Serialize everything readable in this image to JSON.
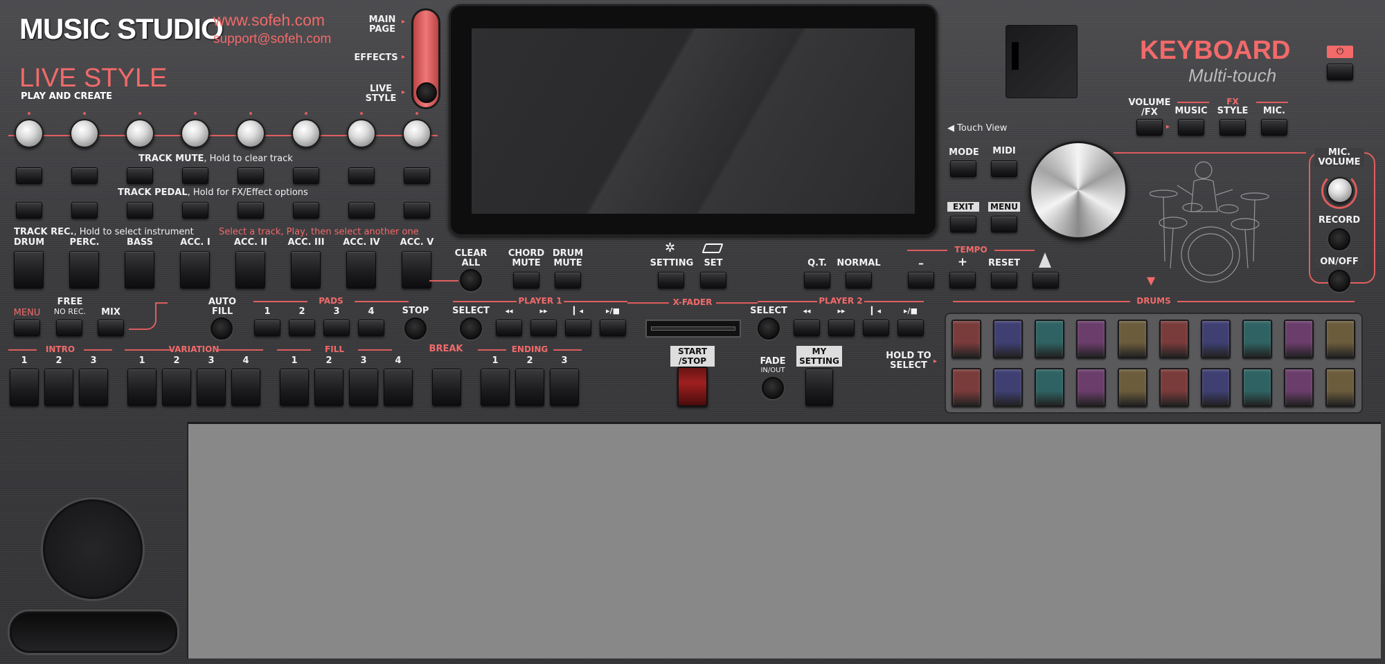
{
  "brand": {
    "title": "MUSIC STUDIO",
    "website": "www.sofeh.com",
    "email": "support@sofeh.com"
  },
  "style_header": {
    "title": "LIVE STYLE",
    "subtitle": "PLAY AND CREATE"
  },
  "page_switch": {
    "main_page": "MAIN PAGE",
    "effects": "EFFECTS",
    "live_style": "LIVE STYLE"
  },
  "keyboard": {
    "title": "KEYBOARD",
    "subtitle": "Multi-touch"
  },
  "touch_view": "Touch View",
  "track_mute_label": "TRACK MUTE",
  "track_mute_hint": ", Hold to clear track",
  "track_pedal_label": "TRACK PEDAL",
  "track_pedal_hint": ", Hold for FX/Effect options",
  "track_rec_label": "TRACK REC.",
  "track_rec_hint": ", Hold to select instrument",
  "track_rec_note": "Select a track, Play, then select another one",
  "tracks": [
    "DRUM",
    "PERC.",
    "BASS",
    "ACC. I",
    "ACC. II",
    "ACC. III",
    "ACC. IV",
    "ACC. V"
  ],
  "clear_all": "CLEAR ALL",
  "chord_mute": "CHORD MUTE",
  "drum_mute": "DRUM MUTE",
  "setting": "SETTING",
  "set": "SET",
  "mode": "MODE",
  "midi": "MIDI",
  "exit": "EXIT",
  "menu_btn": "MENU",
  "qt": "Q.T.",
  "normal": "NORMAL",
  "tempo": {
    "label": "TEMPO",
    "minus": "–",
    "plus": "+",
    "reset": "RESET"
  },
  "fx": {
    "volume_fx": "VOLUME /FX",
    "group": "FX",
    "music": "MUSIC",
    "style": "STYLE",
    "mic": "MIC."
  },
  "mic": {
    "volume": "MIC. VOLUME",
    "record": "RECORD",
    "onoff": "ON/OFF"
  },
  "left_menu": {
    "menu": "MENU",
    "free": "FREE",
    "no_rec": "NO REC.",
    "mix": "MIX",
    "auto_fill": "AUTO FILL"
  },
  "pads": {
    "label": "PADS",
    "items": [
      "1",
      "2",
      "3",
      "4"
    ],
    "stop": "STOP"
  },
  "player1": {
    "label": "PLAYER 1",
    "select": "SELECT"
  },
  "player2": {
    "label": "PLAYER 2",
    "select": "SELECT"
  },
  "xfader": "X-FADER",
  "transport": [
    "◂◂",
    "▸▸",
    "▎◂",
    "▸/■"
  ],
  "drums_label": "DRUMS",
  "hold_to_select": "HOLD TO SELECT",
  "intro": {
    "label": "INTRO",
    "items": [
      "1",
      "2",
      "3"
    ]
  },
  "variation": {
    "label": "VARIATION",
    "items": [
      "1",
      "2",
      "3",
      "4"
    ]
  },
  "fill": {
    "label": "FILL",
    "items": [
      "1",
      "2",
      "3",
      "4"
    ]
  },
  "break": "BREAK",
  "ending": {
    "label": "ENDING",
    "items": [
      "1",
      "2",
      "3"
    ]
  },
  "start_stop": "START /STOP",
  "fade": "FADE",
  "fade_sub": "IN/OUT",
  "my_setting": "MY SETTING",
  "colors": {
    "accent": "#f26a6a",
    "drum_pads": [
      "#7a3b3b",
      "#3f3f72",
      "#2f6262",
      "#6b3d6b",
      "#6b5c3c",
      "#7a3b3b",
      "#3f3f72",
      "#2f6262",
      "#6b3d6b",
      "#6b5c3c"
    ]
  }
}
